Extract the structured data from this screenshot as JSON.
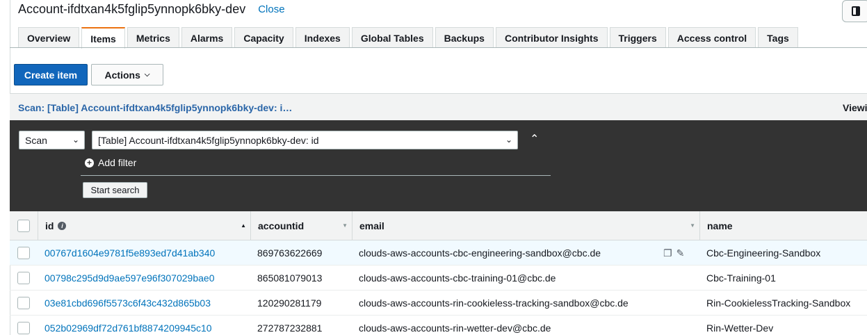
{
  "header": {
    "title": "Account-ifdtxan4k5fglip5ynnopk6bky-dev",
    "close_label": "Close"
  },
  "tabs": [
    {
      "label": "Overview"
    },
    {
      "label": "Items"
    },
    {
      "label": "Metrics"
    },
    {
      "label": "Alarms"
    },
    {
      "label": "Capacity"
    },
    {
      "label": "Indexes"
    },
    {
      "label": "Global Tables"
    },
    {
      "label": "Backups"
    },
    {
      "label": "Contributor Insights"
    },
    {
      "label": "Triggers"
    },
    {
      "label": "Access control"
    },
    {
      "label": "Tags"
    }
  ],
  "active_tab": "Items",
  "toolbar": {
    "create_label": "Create item",
    "actions_label": "Actions"
  },
  "scan_bar": {
    "title": "Scan: [Table] Account-ifdtxan4k5fglip5ynnopk6bky-dev: i…",
    "viewing": "Viewi"
  },
  "query": {
    "mode": "Scan",
    "index": "[Table] Account-ifdtxan4k5fglip5ynnopk6bky-dev: id",
    "add_filter_label": "Add filter",
    "start_search_label": "Start search"
  },
  "table": {
    "columns": {
      "id": "id",
      "accountid": "accountid",
      "email": "email",
      "name": "name"
    },
    "rows": [
      {
        "id": "00767d1604e9781f5e893ed7d41ab340",
        "accountid": "869763622669",
        "email": "clouds-aws-accounts-cbc-engineering-sandbox@cbc.de",
        "name": "Cbc-Engineering-Sandbox"
      },
      {
        "id": "00798c295d9d9ae597e96f307029bae0",
        "accountid": "865081079013",
        "email": "clouds-aws-accounts-cbc-training-01@cbc.de",
        "name": "Cbc-Training-01"
      },
      {
        "id": "03e81cbd696f5573c6f43c432d865b03",
        "accountid": "120290281179",
        "email": "clouds-aws-accounts-rin-cookieless-tracking-sandbox@cbc.de",
        "name": "Rin-CookielessTracking-Sandbox"
      },
      {
        "id": "052b02969df72d761bf8874209945c10",
        "accountid": "272787232881",
        "email": "clouds-aws-accounts-rin-wetter-dev@cbc.de",
        "name": "Rin-Wetter-Dev"
      }
    ]
  },
  "colors": {
    "primary": "#1166bb",
    "link": "#0073bb",
    "tab_accent": "#ec7211",
    "dark_panel": "#333333"
  }
}
